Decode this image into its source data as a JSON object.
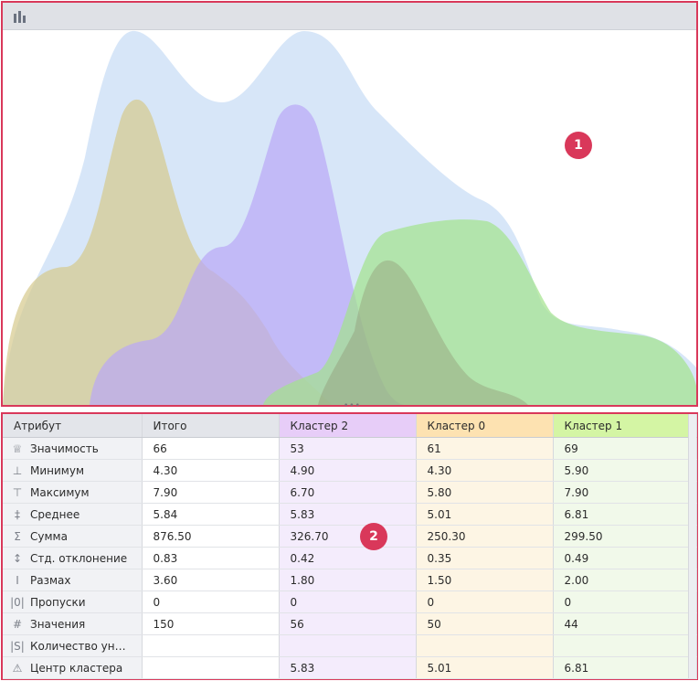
{
  "toolbar": {
    "icon": "bar-chart-icon"
  },
  "annotations": {
    "chart_badge": "1",
    "table_badge": "2"
  },
  "chart_data": {
    "type": "area",
    "series": [
      {
        "key": "total",
        "color": "#c9def5"
      },
      {
        "key": "cluster0",
        "color": "#d5c98c"
      },
      {
        "key": "cluster2",
        "color": "#b9a6f7"
      },
      {
        "key": "cluster1",
        "color": "#a2e38c"
      }
    ]
  },
  "table": {
    "headers": {
      "attr": "Атрибут",
      "total": "Итого",
      "c2": "Кластер 2",
      "c0": "Кластер 0",
      "c1": "Кластер 1"
    },
    "rows": [
      {
        "icon": "♕",
        "iconName": "crown-icon",
        "label": "Значимость",
        "total": "66",
        "c2": "53",
        "c0": "61",
        "c1": "69"
      },
      {
        "icon": "⊥",
        "iconName": "minimum-icon",
        "label": "Минимум",
        "total": "4.30",
        "c2": "4.90",
        "c0": "4.30",
        "c1": "5.90"
      },
      {
        "icon": "⊤",
        "iconName": "maximum-icon",
        "label": "Максимум",
        "total": "7.90",
        "c2": "6.70",
        "c0": "5.80",
        "c1": "7.90"
      },
      {
        "icon": "‡",
        "iconName": "mean-icon",
        "label": "Среднее",
        "total": "5.84",
        "c2": "5.83",
        "c0": "5.01",
        "c1": "6.81"
      },
      {
        "icon": "Σ",
        "iconName": "sum-icon",
        "label": "Сумма",
        "total": "876.50",
        "c2": "326.70",
        "c0": "250.30",
        "c1": "299.50"
      },
      {
        "icon": "↕",
        "iconName": "std-deviation-icon",
        "label": "Стд. отклонение",
        "total": "0.83",
        "c2": "0.42",
        "c0": "0.35",
        "c1": "0.49"
      },
      {
        "icon": "Ι",
        "iconName": "range-icon",
        "label": "Размах",
        "total": "3.60",
        "c2": "1.80",
        "c0": "1.50",
        "c1": "2.00"
      },
      {
        "icon": "|0|",
        "iconName": "missing-icon",
        "label": "Пропуски",
        "total": "0",
        "c2": "0",
        "c0": "0",
        "c1": "0"
      },
      {
        "icon": "#",
        "iconName": "count-icon",
        "label": "Значения",
        "total": "150",
        "c2": "56",
        "c0": "50",
        "c1": "44"
      },
      {
        "icon": "|S|",
        "iconName": "unique-count-icon",
        "label": "Количество ун…",
        "total": "",
        "c2": "",
        "c0": "",
        "c1": ""
      },
      {
        "icon": "⚠",
        "iconName": "cluster-center-icon",
        "label": "Центр кластера",
        "total": "",
        "c2": "5.83",
        "c0": "5.01",
        "c1": "6.81"
      }
    ]
  }
}
